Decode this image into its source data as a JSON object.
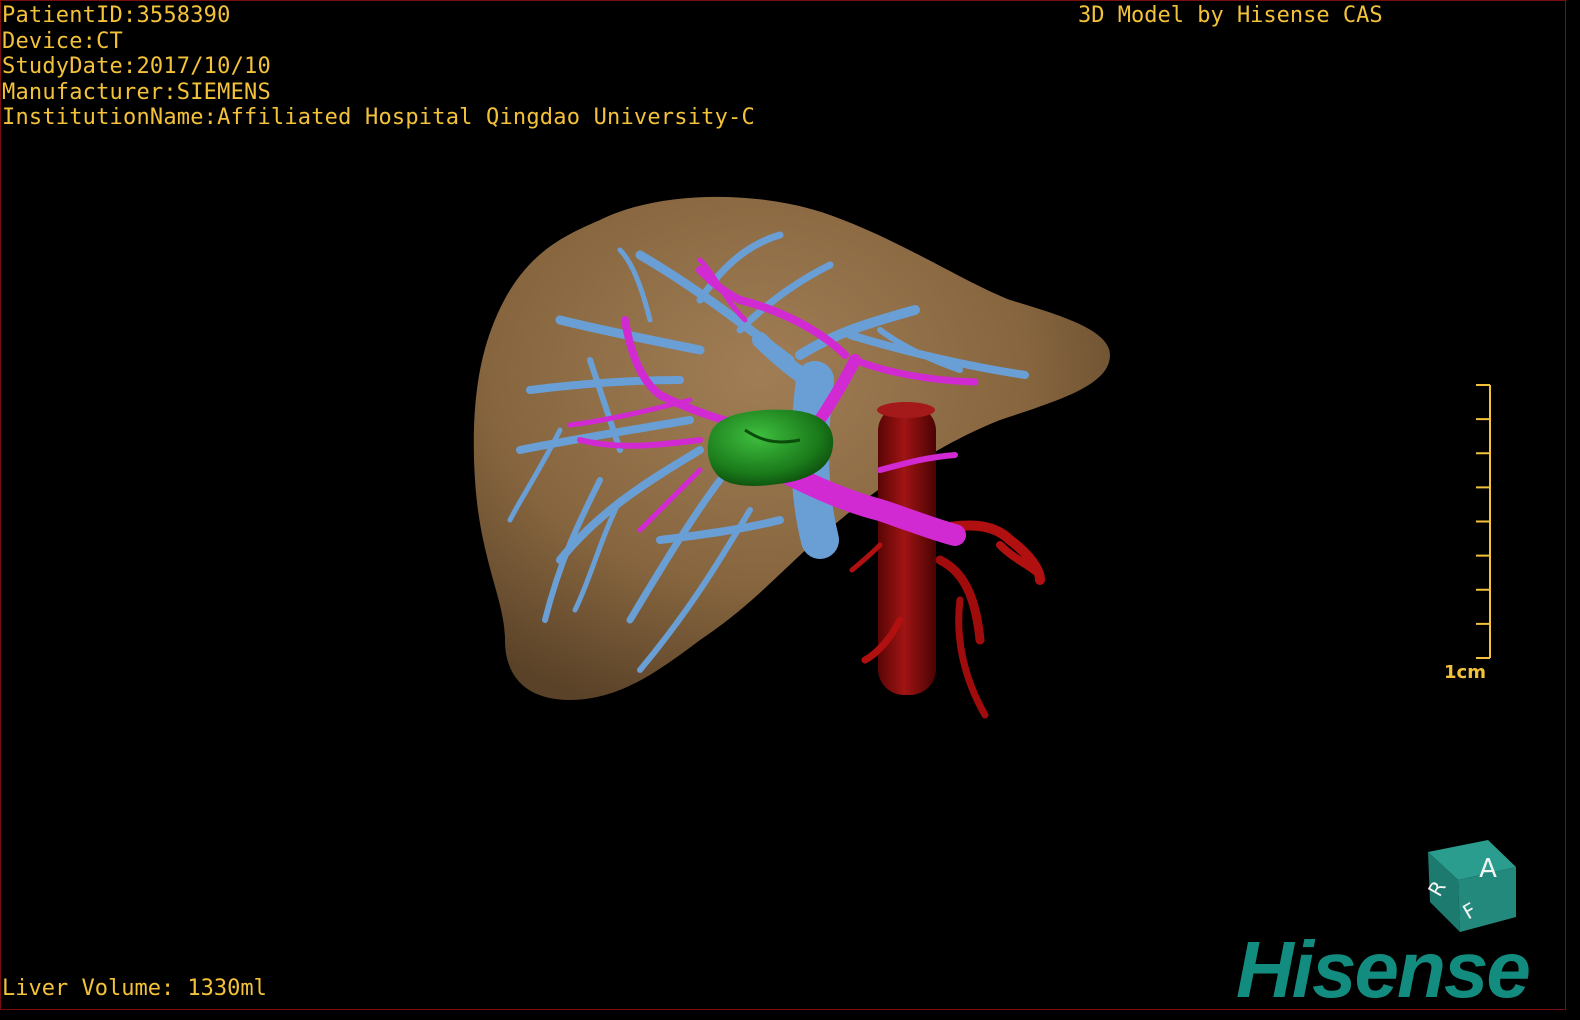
{
  "header": {
    "patient_id": "PatientID:3558390",
    "device": "Device:CT",
    "study_date": "StudyDate:2017/10/10",
    "manufacturer": "Manufacturer:SIEMENS",
    "institution": "InstitutionName:Affiliated Hospital Qingdao University-C"
  },
  "brand_top": "3D Model by Hisense CAS",
  "liver_volume": "Liver Volume: 1330ml",
  "scale": {
    "label": "1cm",
    "ticks": 9
  },
  "orientation_cube": {
    "face_front": "A",
    "face_top": "R",
    "face_side": "F"
  },
  "logo": "Hisense",
  "colors": {
    "text": "#f3c23a",
    "liver": "#8c6a45",
    "hepatic_vein": "#6a9fd6",
    "portal_vein": "#d22ad2",
    "tumor": "#1f8a1f",
    "vena_cava": "#8a0a0a",
    "brand": "#138c80"
  }
}
